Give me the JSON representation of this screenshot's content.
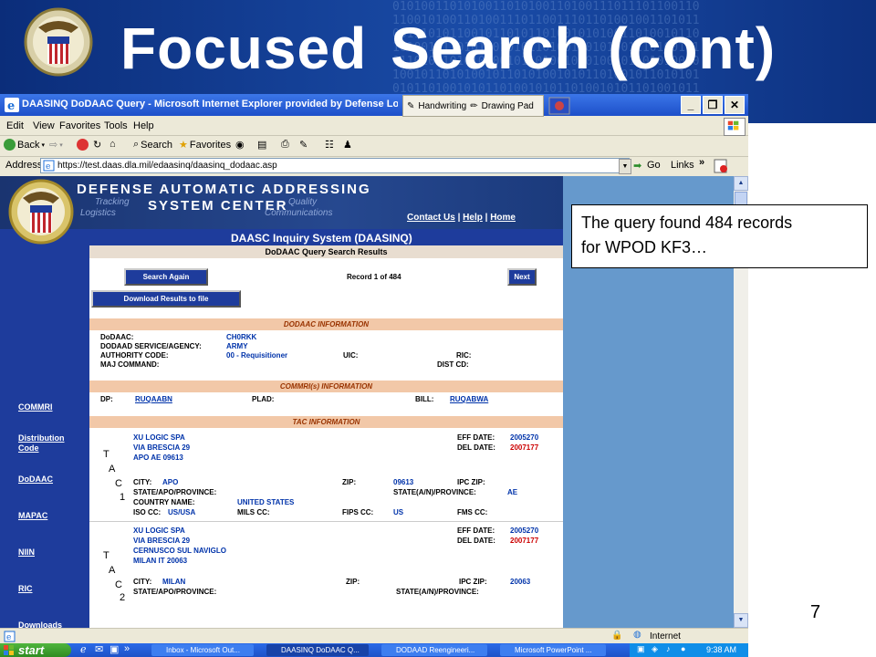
{
  "slide": {
    "title_left": "Focused",
    "title_right": "Search (cont)",
    "number": "7",
    "callout_line1": "The query found 484 records",
    "callout_line2": "for WPOD KF3…"
  },
  "browser": {
    "window_title": "DAASINQ DoDAAC Query - Microsoft Internet Explorer provided by Defense Logistics A",
    "float_toolbar": {
      "handwriting": "Handwriting",
      "drawing_pad": "Drawing Pad"
    },
    "menu": [
      "Edit",
      "View",
      "Favorites",
      "Tools",
      "Help"
    ],
    "toolbar": {
      "back": "Back",
      "search": "Search",
      "favorites": "Favorites"
    },
    "address_label": "Address",
    "address_value": "https://test.daas.dla.mil/edaasinq/daasinq_dodaac.asp",
    "go_label": "Go",
    "links_label": "Links",
    "status_zone": "Internet"
  },
  "page": {
    "banner_line1": "DEFENSE AUTOMATIC ADDRESSING",
    "banner_line2": "SYSTEM CENTER",
    "banner_words": {
      "tracking": "Tracking",
      "logistics": "Logistics",
      "quality": "Quality",
      "communications": "Communications"
    },
    "top_links": {
      "contact": "Contact Us",
      "help": "Help",
      "home": "Home"
    },
    "system_title": "DAASC Inquiry System (DAASINQ)",
    "results_title": "DoDAAC Query Search Results",
    "search_again": "Search Again",
    "record_count": "Record 1 of 484",
    "next": "Next",
    "download": "Download Results to file",
    "nav": [
      "COMMRI",
      "Distribution Code",
      "DoDAAC",
      "MAPAC",
      "NIIN",
      "RIC",
      "Downloads"
    ],
    "dodaac_section": {
      "heading": "DODAAC INFORMATION",
      "dodaac_label": "DoDAAC:",
      "dodaac_value": "CH0RKK",
      "agency_label": "DODAAD SERVICE/AGENCY:",
      "agency_value": "ARMY",
      "authority_label": "AUTHORITY CODE:",
      "authority_value": "00 - Requisitioner",
      "uic_label": "UIC:",
      "ric_label": "RIC:",
      "maj_label": "MAJ COMMAND:",
      "dist_label": "DIST CD:"
    },
    "commri_section": {
      "heading": "COMMRI(s) INFORMATION",
      "dp_label": "DP:",
      "dp_value": "RUQAABN",
      "plad_label": "PLAD:",
      "bill_label": "BILL:",
      "bill_value": "RUQABWA"
    },
    "tac_section": {
      "heading": "TAC INFORMATION",
      "tac1": {
        "letters": [
          "T",
          "A",
          "C",
          "1"
        ],
        "line1": "XU LOGIC SPA",
        "line2": "VIA BRESCIA 29",
        "line3": "APO AE 09613",
        "eff_label": "EFF DATE:",
        "eff_value": "2005270",
        "del_label": "DEL DATE:",
        "del_value": "2007177",
        "city_label": "CITY:",
        "city_value": "APO",
        "zip_label": "ZIP:",
        "zip_value": "09613",
        "ipc_label": "IPC ZIP:",
        "state_label": "STATE/APO/PROVINCE:",
        "state_an_label": "STATE(A/N)/PROVINCE:",
        "state_an_value": "AE",
        "country_label": "COUNTRY NAME:",
        "country_value": "UNITED STATES",
        "iso_label": "ISO CC:",
        "iso_value": "US/USA",
        "mils_label": "MILS CC:",
        "fips_label": "FIPS CC:",
        "fips_value": "US",
        "fms_label": "FMS CC:"
      },
      "tac2": {
        "letters": [
          "T",
          "A",
          "C",
          "2"
        ],
        "line1": "XU LOGIC SPA",
        "line2": "VIA BRESCIA 29",
        "line3": "CERNUSCO SUL NAVIGLO",
        "line4": "MILAN IT 20063",
        "eff_label": "EFF DATE:",
        "eff_value": "2005270",
        "del_label": "DEL DATE:",
        "del_value": "2007177",
        "city_label": "CITY:",
        "city_value": "MILAN",
        "zip_label": "ZIP:",
        "ipc_label": "IPC ZIP:",
        "ipc_value": "20063",
        "state_label": "STATE/APO/PROVINCE:",
        "state_an_label": "STATE(A/N)/PROVINCE:"
      }
    }
  },
  "taskbar": {
    "start": "start",
    "items": [
      "Inbox - Microsoft Out...",
      "DAASINQ DoDAAC Q...",
      "DODAAD Reengineeri...",
      "Microsoft PowerPoint ..."
    ],
    "clock": "9:38 AM"
  }
}
